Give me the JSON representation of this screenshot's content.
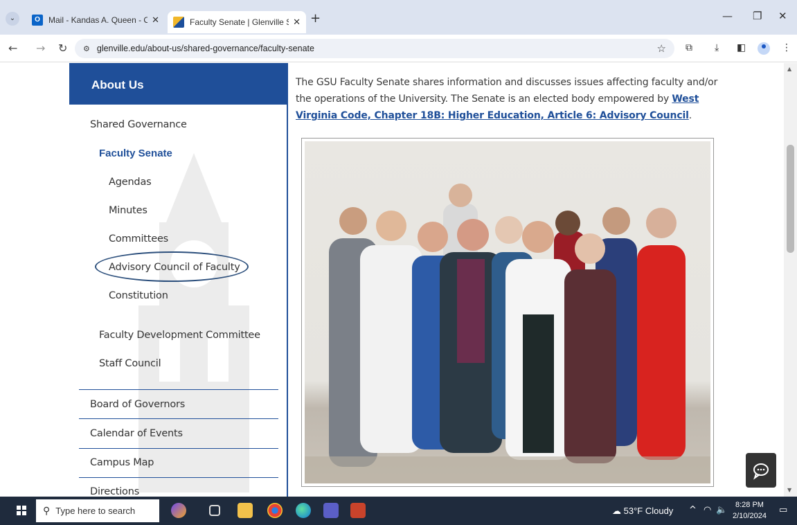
{
  "browser": {
    "tabs": [
      {
        "title": "Mail - Kandas A. Queen - Outlo",
        "favicon": "outlook-icon",
        "active": false
      },
      {
        "title": "Faculty Senate | Glenville State",
        "favicon": "glenville-icon",
        "active": true
      }
    ],
    "url": "glenville.edu/about-us/shared-governance/faculty-senate"
  },
  "sidebar": {
    "header": "About Us",
    "items": [
      {
        "label": "Shared Governance"
      },
      {
        "label": "Faculty Senate"
      },
      {
        "label": "Agendas"
      },
      {
        "label": "Minutes"
      },
      {
        "label": "Committees"
      },
      {
        "label": "Advisory Council of Faculty"
      },
      {
        "label": "Constitution"
      },
      {
        "label": "Faculty Development Committee"
      },
      {
        "label": "Staff Council"
      },
      {
        "label": "Board of Governors"
      },
      {
        "label": "Calendar of Events"
      },
      {
        "label": "Campus Map"
      },
      {
        "label": "Directions"
      }
    ]
  },
  "content": {
    "intro_text": "The GSU Faculty Senate shares information and discusses issues affecting faculty and/or the operations of the University. The Senate is an elected body empowered by ",
    "intro_link": "West Virginia Code, Chapter 18B: Higher Education, Article 6: Advisory Council",
    "intro_end": "."
  },
  "taskbar": {
    "search_placeholder": "Type here to search",
    "weather": "53°F  Cloudy",
    "time": "8:28 PM",
    "date": "2/10/2024"
  },
  "colors": {
    "brand_blue": "#1f4f99",
    "taskbar": "#1f2b3d"
  }
}
